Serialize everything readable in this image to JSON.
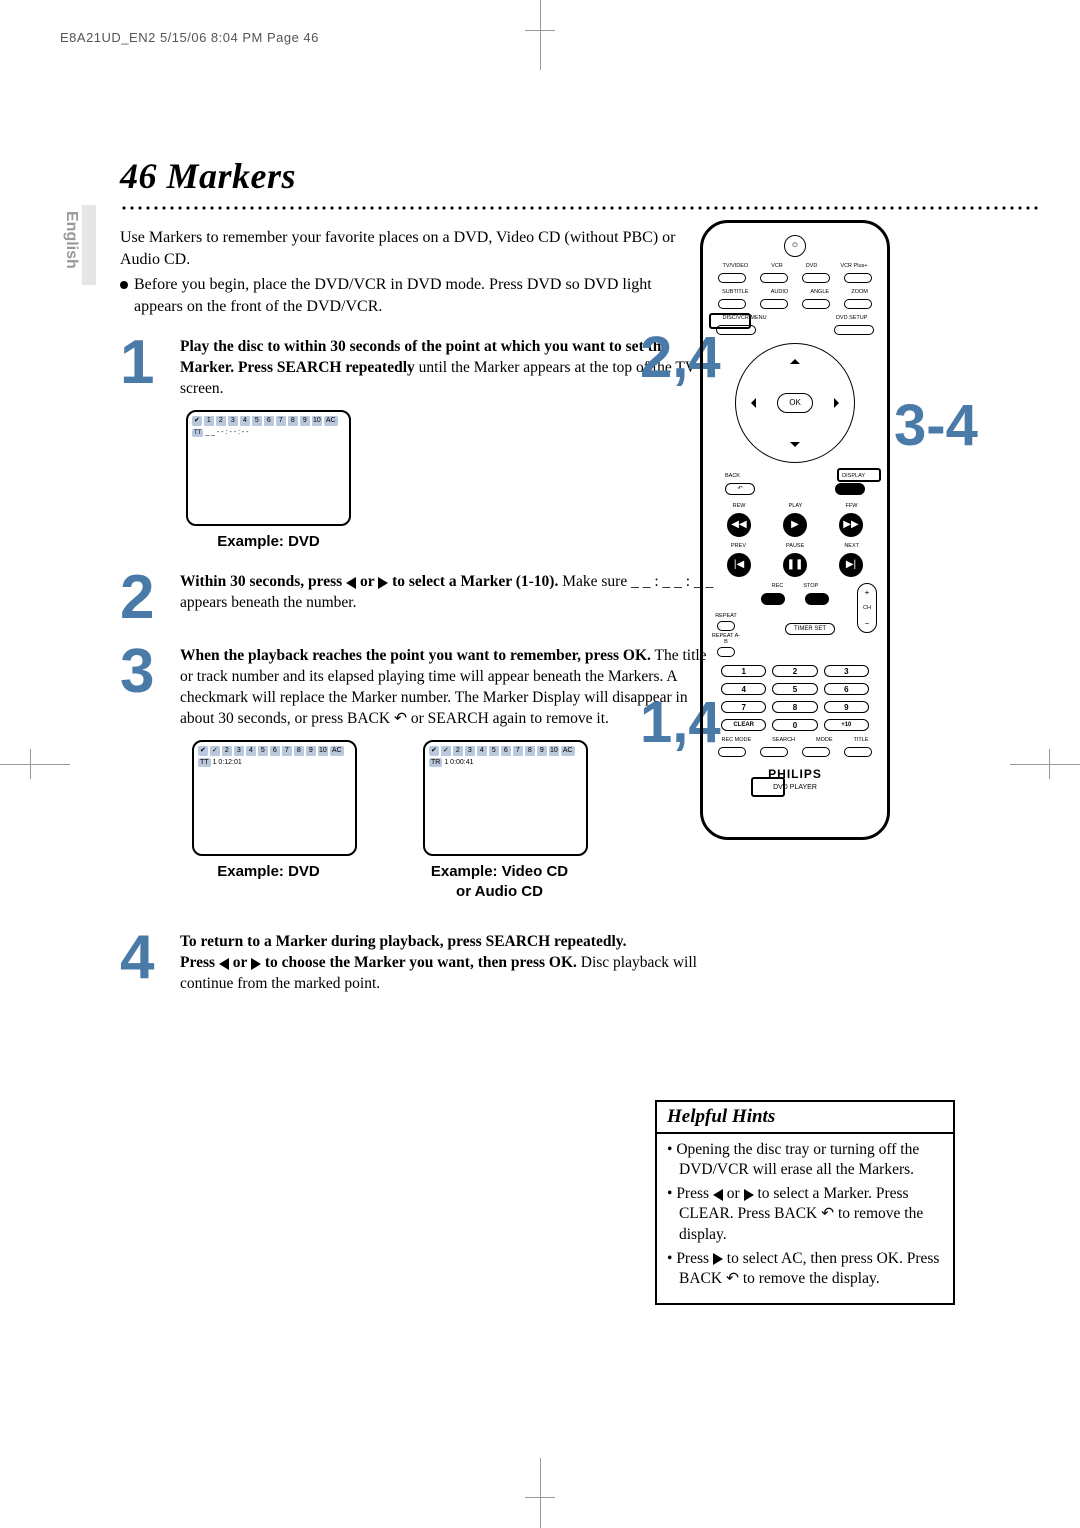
{
  "meta": {
    "header": "E8A21UD_EN2  5/15/06  8:04 PM  Page 46",
    "lang_tab": "English"
  },
  "title": {
    "page_num": "46",
    "word": "Markers",
    "full": "46  Markers"
  },
  "intro": {
    "line1": "Use Markers to remember your favorite places on a DVD, Video CD (without PBC) or Audio CD.",
    "bullet": "Before you begin, place the DVD/VCR in DVD mode. Press DVD so DVD light appears on the front of the DVD/VCR."
  },
  "steps": {
    "s1": {
      "bold": "Play the disc to within 30 seconds of the point at which you want to set the Marker. Press SEARCH repeatedly",
      "rest": " until the Marker appears at the top of the TV screen.",
      "example": "Example: DVD"
    },
    "s2": {
      "bold_a": "Within 30 seconds, press ",
      "bold_b": " or ",
      "bold_c": " to select a Marker (1-10).",
      "rest": " Make sure  _ _ : _ _ : _ _  appears beneath the number."
    },
    "s3": {
      "bold": "When the playback reaches the point you want to remember, press OK.",
      "rest": " The title or track number and its elapsed playing time will appear beneath the Markers. A checkmark will replace the Marker number. The Marker Display will disappear in about 30 seconds, or press BACK ",
      "rest2": " or SEARCH again to remove it.",
      "example_dvd": "Example: DVD",
      "example_cd_a": "Example: Video CD",
      "example_cd_b": "or Audio CD",
      "osd_dvd": "1  0:12:01",
      "osd_cd": "1   0:00:41"
    },
    "s4": {
      "bold_a": "To return to a Marker during playback, press SEARCH repeatedly.",
      "bold_b": "Press ",
      "bold_c": " or ",
      "bold_d": " to choose the Marker you want, then press OK.",
      "rest": " Disc playback will continue from the marked point."
    }
  },
  "callouts": {
    "n24": "2,4",
    "n34": "3-4",
    "n14": "1,4"
  },
  "remote": {
    "row1": [
      "TV/VIDEO",
      "VCR",
      "DVD",
      "VCR Plus+"
    ],
    "row2": [
      "SUBTITLE",
      "AUDIO",
      "ANGLE",
      "ZOOM"
    ],
    "row3": [
      "DISC/VCR MENU",
      "",
      "",
      "DVD SETUP"
    ],
    "ok": "OK",
    "back": "BACK",
    "display": "DISPLAY",
    "transport1": [
      "REW",
      "PLAY",
      "FFW"
    ],
    "transport2": [
      "PREV",
      "PAUSE",
      "NEXT"
    ],
    "transport3": [
      "REC",
      "STOP"
    ],
    "side": [
      "REPEAT",
      "REPEAT A-B",
      "TIMER SET",
      "CH",
      "+",
      "−"
    ],
    "numpad": [
      "1",
      "2",
      "3",
      "4",
      "5",
      "6",
      "7",
      "8",
      "9",
      "CLEAR",
      "0",
      "+10"
    ],
    "bottom": [
      "REC MODE",
      "SEARCH",
      "MODE",
      "TITLE"
    ],
    "brand": "PHILIPS",
    "sub": "DVD PLAYER"
  },
  "hints": {
    "title": "Helpful Hints",
    "items": {
      "a": "Opening the disc tray or turning off the DVD/VCR will erase all the Markers.",
      "b_1": "Press ",
      "b_2": " or ",
      "b_3": " to select a Marker. Press CLEAR. Press BACK ",
      "b_4": " to remove the display.",
      "c_1": "Press ",
      "c_2": " to select AC, then press OK. Press BACK ",
      "c_3": " to remove the display."
    }
  }
}
